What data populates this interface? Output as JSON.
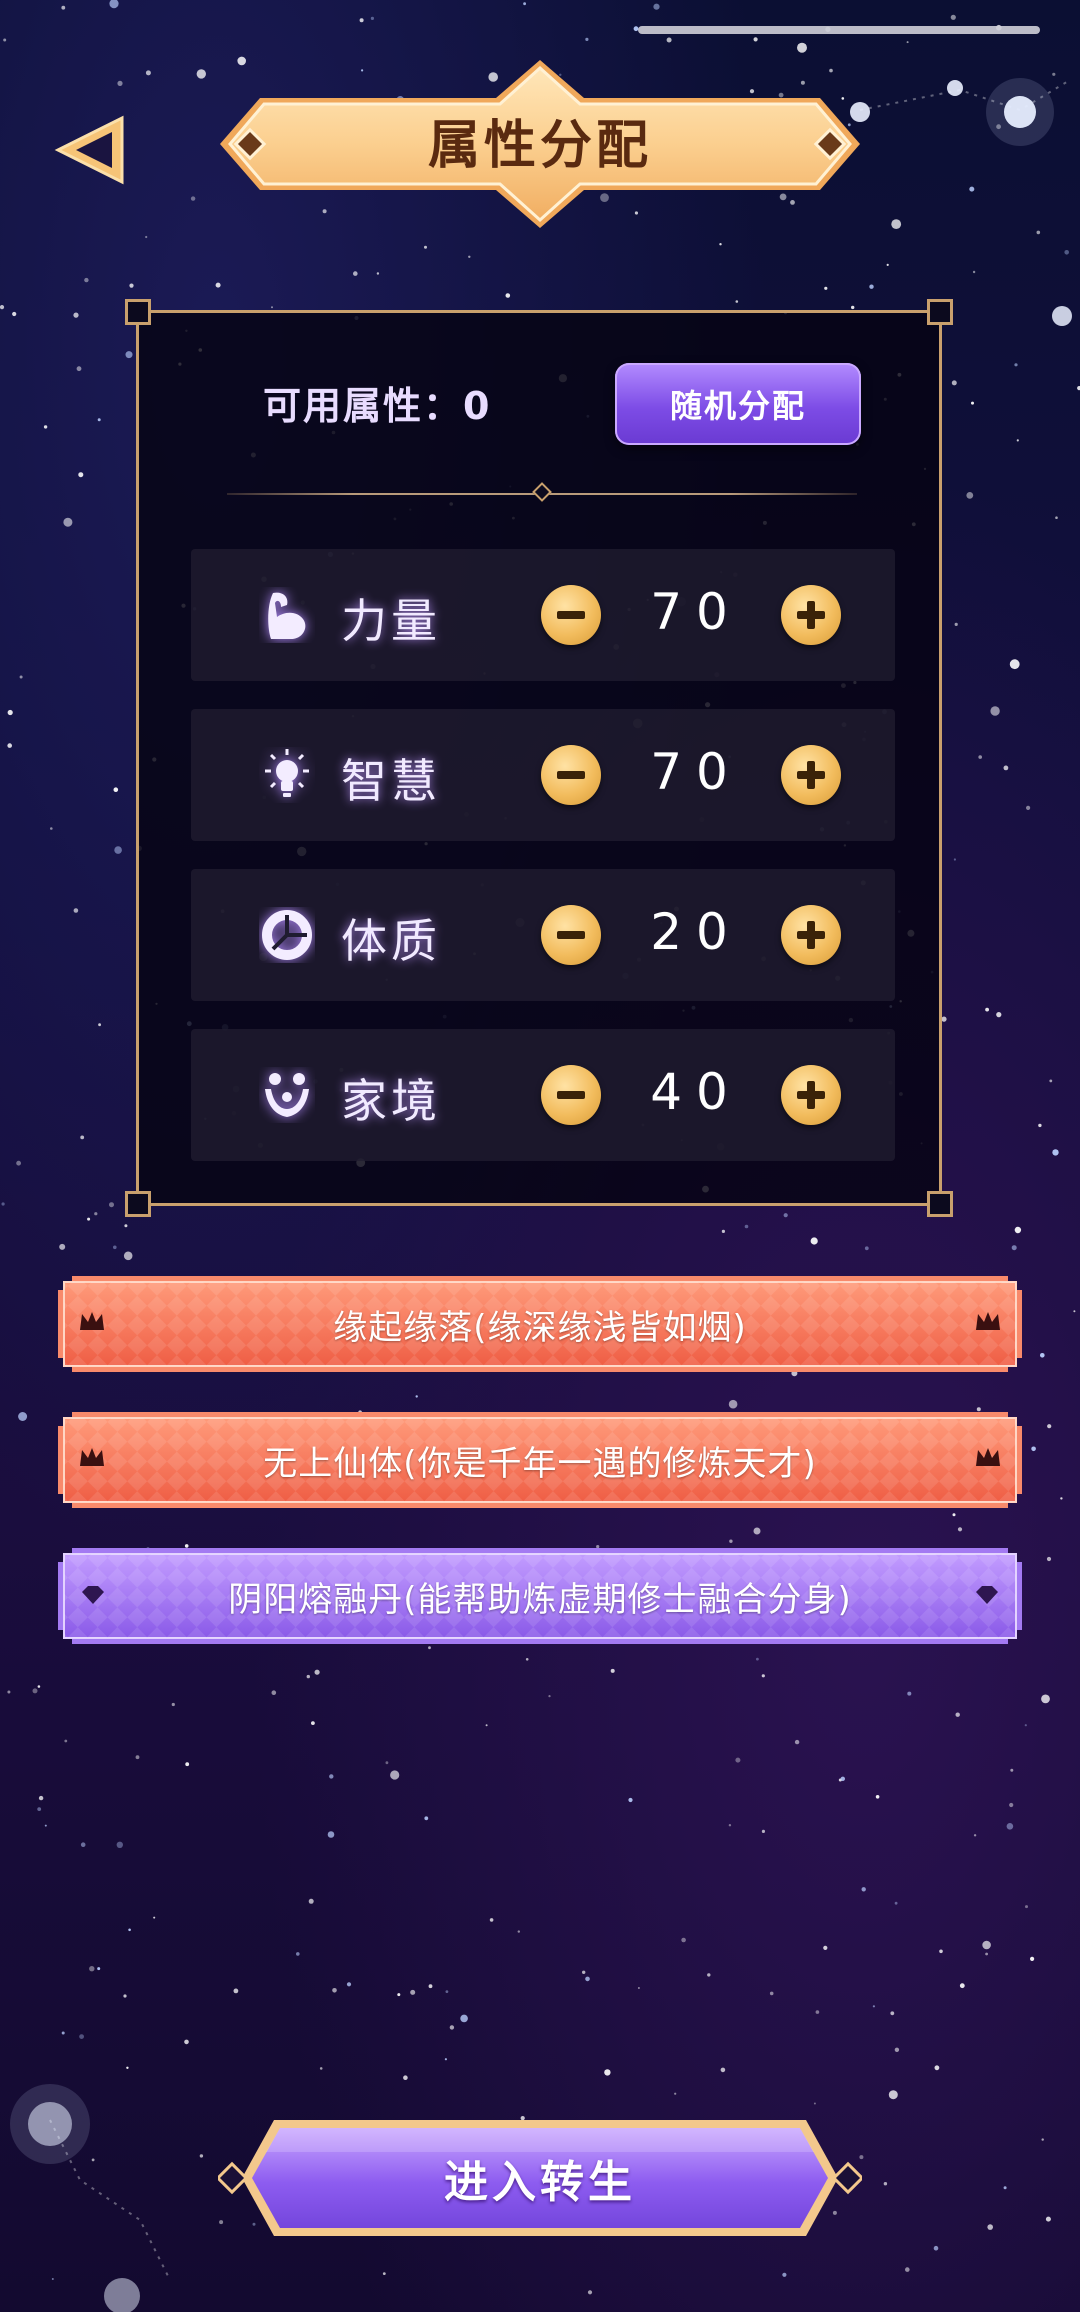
{
  "header": {
    "title": "属性分配"
  },
  "panel": {
    "points_label": "可用属性：0",
    "random_label": "随机分配",
    "attributes": [
      {
        "icon": "muscle-arm-icon",
        "label": "力量",
        "value": "70"
      },
      {
        "icon": "lightbulb-icon",
        "label": "智慧",
        "value": "70"
      },
      {
        "icon": "constitution-ring-icon",
        "label": "体质",
        "value": "20"
      },
      {
        "icon": "family-icon",
        "label": "家境",
        "value": "40"
      }
    ]
  },
  "talents": [
    {
      "text": "缘起缘落(缘深缘浅皆如烟)",
      "style": "orange",
      "icon": "crown-icon"
    },
    {
      "text": "无上仙体(你是千年一遇的修炼天才)",
      "style": "orange",
      "icon": "crown-icon"
    },
    {
      "text": "阴阳熔融丹(能帮助炼虚期修士融合分身)",
      "style": "purple",
      "icon": "gem-icon"
    }
  ],
  "footer": {
    "enter_label": "进入转生"
  },
  "colors": {
    "gold_banner": "#f9c88a",
    "purple_button": "#7d4ce6",
    "orange_talent": "#f0644a",
    "purple_talent": "#9a6cf0",
    "panel_border": "#c9a06d"
  }
}
